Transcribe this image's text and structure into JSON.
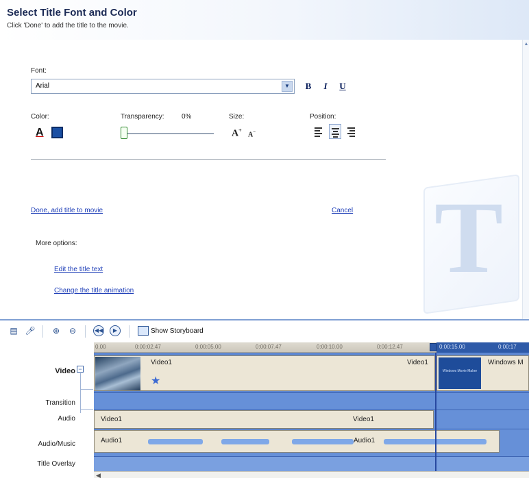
{
  "pane": {
    "title": "Select Title Font and Color",
    "subtitle": "Click 'Done' to add the title to the movie.",
    "font_label": "Font:",
    "font_value": "Arial",
    "bold_label": "B",
    "italic_label": "I",
    "underline_label": "U",
    "color_label": "Color:",
    "color_swatch": "#1a4fa3",
    "transparency_label": "Transparency:",
    "transparency_value": "0%",
    "size_label": "Size:",
    "position_label": "Position:",
    "done_link": "Done, add title to movie",
    "cancel_link": "Cancel",
    "more_options_label": "More options:",
    "more_options": [
      "Edit the title text",
      "Change the title animation"
    ]
  },
  "timeline": {
    "show_storyboard_label": "Show Storyboard",
    "ruler_ticks": [
      "0.00",
      "0:00:02.47",
      "0:00:05.00",
      "0:00:07.47",
      "0:00:10.00",
      "0:00:12.47",
      "0:00:15.00",
      "0:00:17"
    ],
    "tracks": {
      "video": "Video",
      "transition": "Transition",
      "audio": "Audio",
      "audio_music": "Audio/Music",
      "title_overlay": "Title Overlay"
    },
    "expand_symbol": "−",
    "clips": {
      "video_clip_1_left": "Video1",
      "video_clip_1_right": "Video1",
      "wmm_thumb_text": "Windows Movie Maker",
      "video_clip_2": "Windows M",
      "audio_clip_left": "Video1",
      "audio_clip_right": "Video1",
      "music_clip_left": "Audio1",
      "music_clip_right": "Audio1"
    }
  }
}
